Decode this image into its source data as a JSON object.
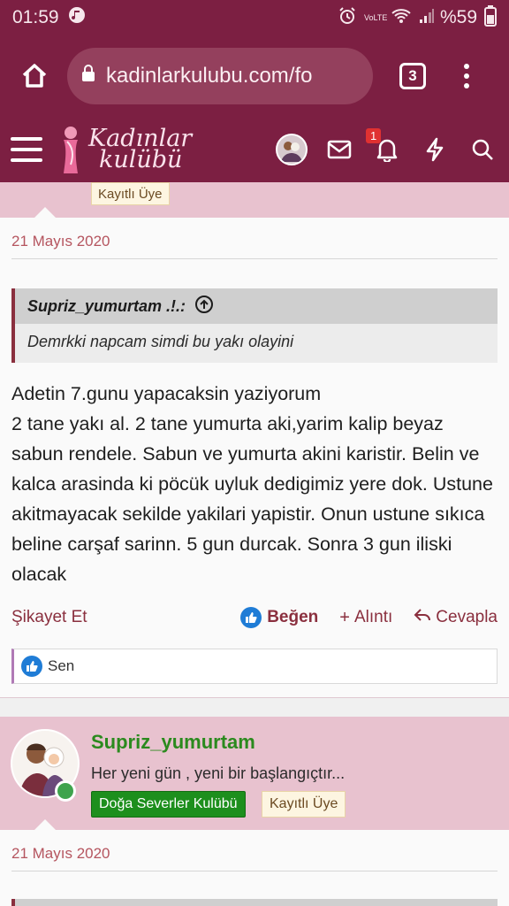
{
  "status_bar": {
    "time": "01:59",
    "network": "VoLTE",
    "battery": "%59"
  },
  "browser": {
    "url": "kadinlarkulubu.com/fo",
    "tab_count": "3"
  },
  "site": {
    "logo_line1": "Kadınlar",
    "logo_line2": "kulübü",
    "notification_count": "1"
  },
  "post1": {
    "user_tag": "Kayıtlı Üye",
    "date": "21 Mayıs 2020",
    "quote_author": "Supriz_yumurtam .!.:",
    "quote_text": "Demrkki napcam simdi bu yakı olayini",
    "body": "Adetin 7.gunu yapacaksin yaziyorum\n2 tane yakı al. 2 tane yumurta aki,yarim kalip beyaz sabun rendele. Sabun ve yumurta akini karistir. Belin ve kalca arasinda ki pöcük uyluk dedigimiz yere dok. Ustune akitmayacak sekilde yakilari yapistir. Onun ustune sıkıca beline carşaf sarinn. 5 gun durcak. Sonra 3 gun iliski olacak",
    "actions": {
      "report": "Şikayet Et",
      "like": "Beğen",
      "quote": "Alıntı",
      "reply": "Cevapla"
    },
    "likes": "Sen"
  },
  "post2": {
    "username": "Supriz_yumurtam",
    "motto": "Her yeni gün , yeni bir başlangıçtır...",
    "group_tag": "Doğa Severler Kulübü",
    "user_tag": "Kayıtlı Üye",
    "date": "21 Mayıs 2020"
  },
  "colors": {
    "brand": "#7c1f42",
    "user_block": "#e8c2cf",
    "accent": "#8a2f3e",
    "online": "#3fa34d",
    "like_blue": "#1f7cd6"
  }
}
